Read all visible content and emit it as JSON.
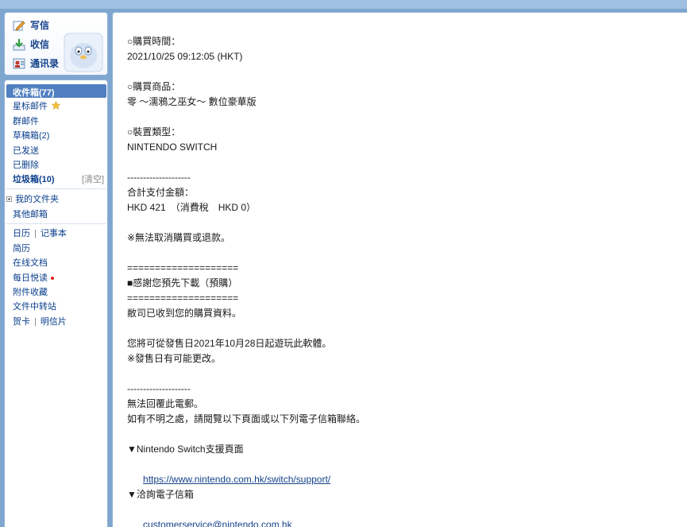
{
  "quick_actions": [
    {
      "label": "写信"
    },
    {
      "label": "收信"
    },
    {
      "label": "通讯录"
    }
  ],
  "nav": {
    "inbox": "收件箱(77)",
    "starred": "星标邮件",
    "group": "群邮件",
    "drafts": "草稿箱(2)",
    "sent": "已发送",
    "deleted": "已删除",
    "spam": "垃圾箱(10)",
    "spam_clear": "[清空]",
    "my_folders": "我的文件夹",
    "other_mailbox": "其他邮箱",
    "calendar": "日历",
    "notepad": "记事本",
    "resume": "简历",
    "online_docs": "在线文档",
    "daily_reading": "每日悦读",
    "attachments": "附件收藏",
    "file_transfer": "文件中转站",
    "greeting_card": "贺卡",
    "postcard": "明信片",
    "separator": "|"
  },
  "email": {
    "lines": [
      "○購買時間：",
      "2021/10/25 09:12:05 (HKT)",
      "",
      "○購買商品：",
      "零 ～濡鴉之巫女～ 數位豪華版",
      "",
      "○裝置類型：",
      "NINTENDO SWITCH",
      "",
      "--------------------",
      "合計支付金額：",
      "HKD 421　（消費稅　HKD 0）",
      "",
      "※無法取消購買或退款。",
      "",
      "====================",
      "■感謝您預先下載（預購）",
      "====================",
      "敝司已收到您的購買資料。",
      "",
      "您將可從發售日2021年10月28日起遊玩此軟體。",
      "※發售日有可能更改。",
      "",
      "--------------------",
      "無法回覆此電郵。",
      "如有不明之處，請閱覽以下頁面或以下列電子信箱聯絡。",
      "",
      "▼Nintendo Switch支援頁面"
    ],
    "support_link": "https://www.nintendo.com.hk/switch/support/",
    "email_heading": "▼洽詢電子信箱",
    "email_link": "customerservice@nintendo.com.hk"
  }
}
